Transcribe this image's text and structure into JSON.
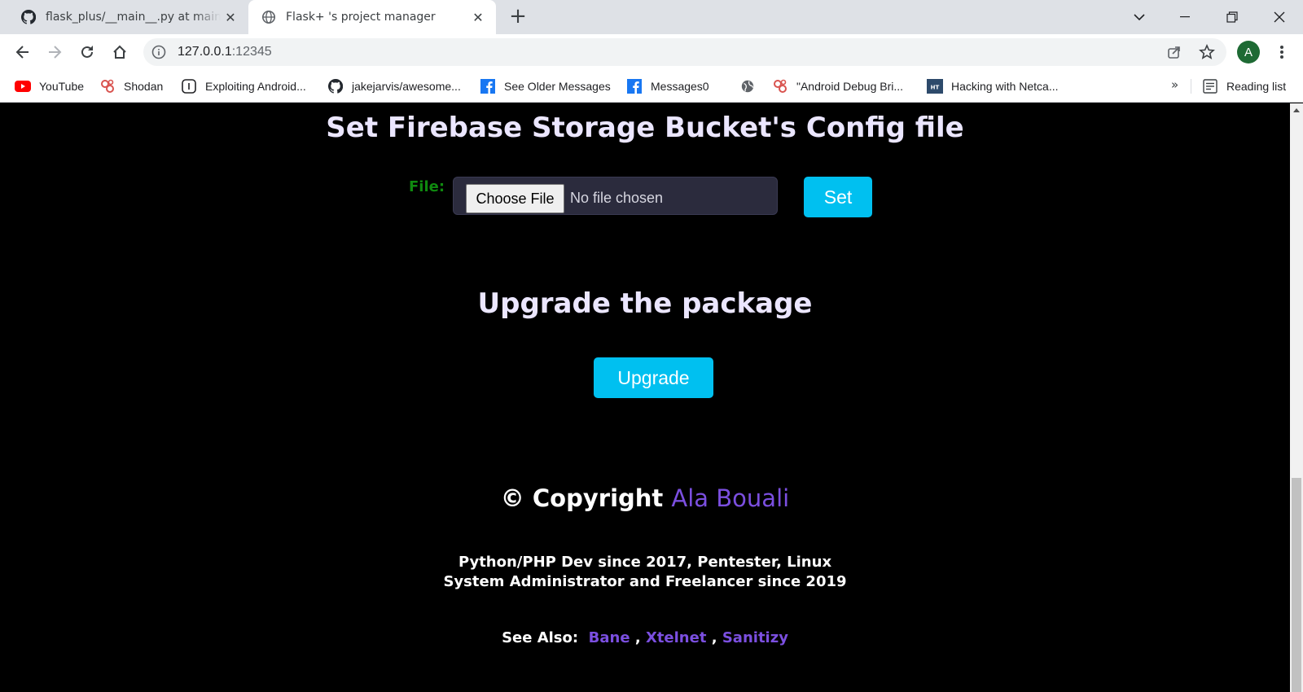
{
  "browser": {
    "tabs": [
      {
        "title": "flask_plus/__main__.py at main · Ala",
        "favicon": "github-icon",
        "active": false
      },
      {
        "title": "Flask+ 's project manager",
        "favicon": "globe-icon",
        "active": true
      }
    ],
    "address": {
      "host": "127.0.0.1",
      "port": ":12345"
    },
    "avatar_letter": "A",
    "bookmarks": [
      {
        "label": "YouTube",
        "icon": "youtube-icon"
      },
      {
        "label": "Shodan",
        "icon": "shodan-icon"
      },
      {
        "label": "Exploiting Android...",
        "icon": "bookmark-page-icon"
      },
      {
        "label": "jakejarvis/awesome...",
        "icon": "github-icon"
      },
      {
        "label": "See Older Messages",
        "icon": "facebook-icon"
      },
      {
        "label": "Messages0",
        "icon": "facebook-icon"
      },
      {
        "label": "",
        "icon": "globe-icon"
      },
      {
        "label": "\"Android Debug Bri...",
        "icon": "shodan-icon"
      },
      {
        "label": "Hacking with Netca...",
        "icon": "ht-icon"
      }
    ],
    "more_bookmarks": "»",
    "reading_list": "Reading list"
  },
  "firebase": {
    "heading": "Set Firebase Storage Bucket's Config file",
    "file_label": "File:",
    "choose_button": "Choose File",
    "no_file_text": "No file chosen",
    "set_button": "Set"
  },
  "upgrade": {
    "heading": "Upgrade the package",
    "button": "Upgrade"
  },
  "footer": {
    "copyright_prefix": "© Copyright",
    "author": "Ala Bouali",
    "bio_line1": "Python/PHP Dev since 2017, Pentester, Linux",
    "bio_line2": "System Administrator and Freelancer since 2019",
    "see_also_label": "See Also:",
    "links": [
      "Bane",
      "Xtelnet",
      "Sanitizy"
    ],
    "separator": ","
  },
  "colors": {
    "accent_cyan": "#00c0f0",
    "author_purple": "#7b4fe0",
    "file_label_green": "#0f8a0f",
    "page_background": "#000000"
  }
}
